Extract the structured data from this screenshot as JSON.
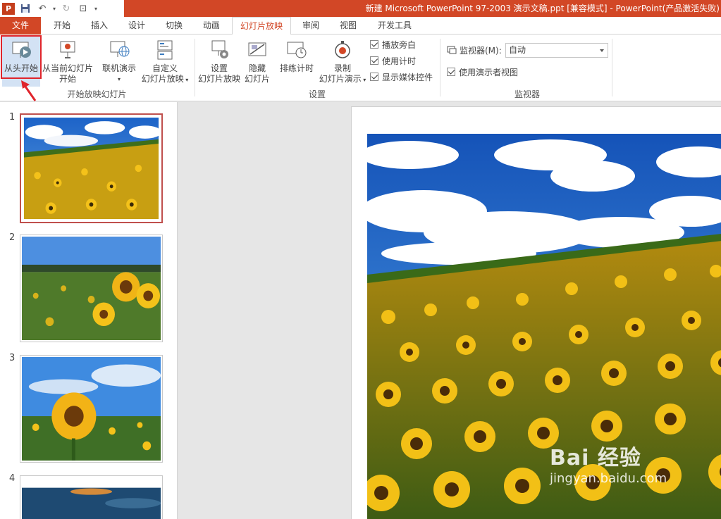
{
  "window": {
    "title": "新建 Microsoft PowerPoint 97-2003 演示文稿.ppt [兼容模式] - PowerPoint(产品激活失败)",
    "app_icon": "P"
  },
  "tabs": [
    "文件",
    "开始",
    "插入",
    "设计",
    "切换",
    "动画",
    "幻灯片放映",
    "审阅",
    "视图",
    "开发工具"
  ],
  "active_tab": "幻灯片放映",
  "ribbon": {
    "start_group": {
      "label": "开始放映幻灯片",
      "from_beginning": "从头开始",
      "from_current_1": "从当前幻灯片",
      "from_current_2": "开始",
      "online_1": "联机演示",
      "custom_1": "自定义",
      "custom_2": "幻灯片放映"
    },
    "setup_group": {
      "label": "设置",
      "setup_1": "设置",
      "setup_2": "幻灯片放映",
      "hide_1": "隐藏",
      "hide_2": "幻灯片",
      "rehearse": "排练计时",
      "record_1": "录制",
      "record_2": "幻灯片演示",
      "chk_narration": "播放旁白",
      "chk_timings": "使用计时",
      "chk_media": "显示媒体控件"
    },
    "monitor_group": {
      "label": "监视器",
      "monitor_label": "监视器(M):",
      "monitor_value": "自动",
      "presenter_view": "使用演示者视图"
    }
  },
  "slides": [
    {
      "number": "1"
    },
    {
      "number": "2"
    },
    {
      "number": "3"
    },
    {
      "number": "4"
    }
  ],
  "watermark": {
    "brand": "Bai 经验",
    "url": "jingyan.baidu.com"
  }
}
